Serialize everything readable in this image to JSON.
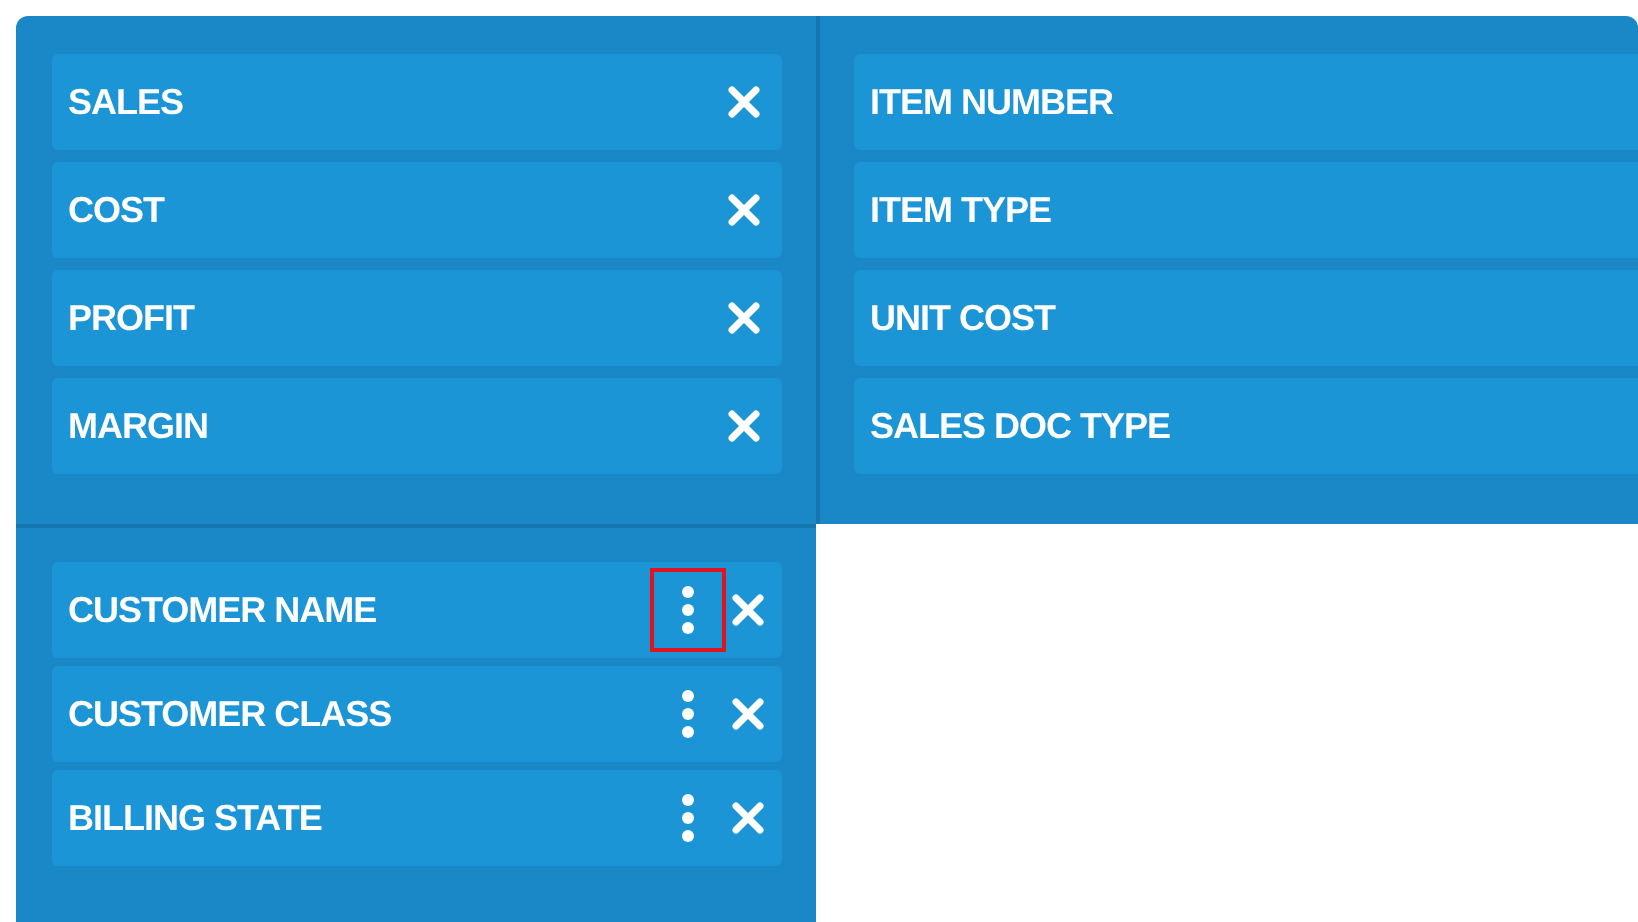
{
  "measures": [
    {
      "label": "SALES"
    },
    {
      "label": "COST"
    },
    {
      "label": "PROFIT"
    },
    {
      "label": "MARGIN"
    }
  ],
  "columns": [
    {
      "label": "ITEM NUMBER"
    },
    {
      "label": "ITEM TYPE"
    },
    {
      "label": "UNIT COST"
    },
    {
      "label": "SALES DOC TYPE"
    }
  ],
  "rows": [
    {
      "label": "CUSTOMER NAME",
      "highlighted": true
    },
    {
      "label": "CUSTOMER CLASS",
      "highlighted": false
    },
    {
      "label": "BILLING STATE",
      "highlighted": false
    }
  ]
}
